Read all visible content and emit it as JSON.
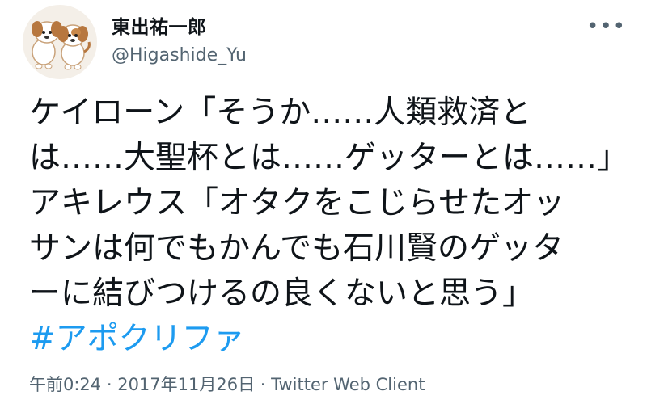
{
  "user": {
    "display_name": "東出祐一郎",
    "handle": "@Higashide_Yu"
  },
  "tweet": {
    "lines": [
      "ケイローン「そうか……人類救済と",
      "は……大聖杯とは……ゲッターとは……」",
      "アキレウス「オタクをこじらせたオッ",
      "サンは何でもかんでも石川賢のゲッタ",
      "ーに結びつけるの良くないと思う」"
    ],
    "hashtag": "#アポクリファ"
  },
  "meta": {
    "time": "午前0:24",
    "separator1": " · ",
    "date": "2017年11月26日",
    "separator2": " · ",
    "source": "Twitter Web Client"
  },
  "icons": {
    "avatar": "dog-avatar-icon",
    "more": "more-options-icon"
  },
  "colors": {
    "text": "#0f1419",
    "secondary": "#536471",
    "link": "#1d9bf0"
  }
}
